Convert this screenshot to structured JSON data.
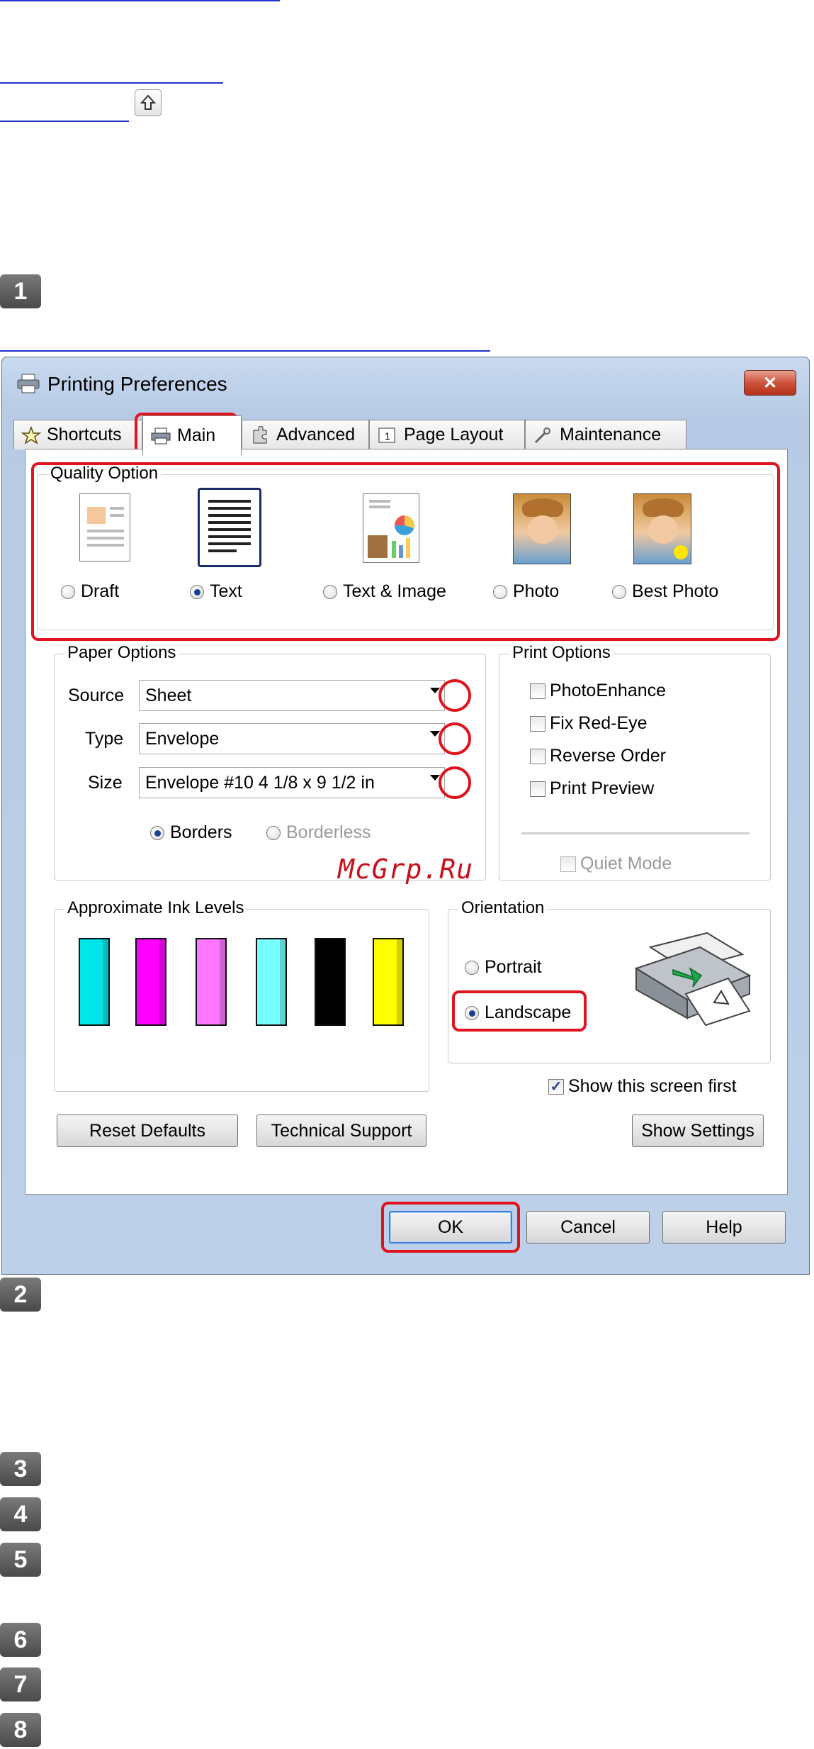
{
  "doc": {
    "steps": [
      "1",
      "2",
      "3",
      "4",
      "5",
      "6",
      "7",
      "8"
    ],
    "watermark": "McGrp.Ru"
  },
  "dialog": {
    "title": "Printing Preferences",
    "close_label": "✕",
    "tabs": [
      {
        "label": "Shortcuts",
        "icon": "star-icon"
      },
      {
        "label": "Main",
        "icon": "printer-icon",
        "active": true
      },
      {
        "label": "Advanced",
        "icon": "puzzle-icon"
      },
      {
        "label": "Page Layout",
        "icon": "page-layout-icon"
      },
      {
        "label": "Maintenance",
        "icon": "wrench-icon"
      }
    ],
    "quality": {
      "title": "Quality Option",
      "options": [
        {
          "label": "Draft",
          "selected": false
        },
        {
          "label": "Text",
          "selected": true
        },
        {
          "label": "Text & Image",
          "selected": false
        },
        {
          "label": "Photo",
          "selected": false
        },
        {
          "label": "Best Photo",
          "selected": false
        }
      ]
    },
    "paper": {
      "title": "Paper Options",
      "source_label": "Source",
      "source_value": "Sheet",
      "type_label": "Type",
      "type_value": "Envelope",
      "size_label": "Size",
      "size_value": "Envelope #10 4 1/8 x 9 1/2 in",
      "borders_label": "Borders",
      "borderless_label": "Borderless"
    },
    "print_options": {
      "title": "Print Options",
      "items": [
        "PhotoEnhance",
        "Fix Red-Eye",
        "Reverse Order",
        "Print Preview"
      ],
      "quiet_mode": "Quiet Mode"
    },
    "ink": {
      "title": "Approximate Ink Levels",
      "colors": [
        "#00e5e8",
        "#ff00ff",
        "#ff77ff",
        "#77ffff",
        "#000000",
        "#ffff00"
      ]
    },
    "orientation": {
      "title": "Orientation",
      "portrait": "Portrait",
      "landscape": "Landscape"
    },
    "show_first": "Show this screen first",
    "buttons": {
      "reset": "Reset Defaults",
      "tech": "Technical Support",
      "show_settings": "Show Settings",
      "ok": "OK",
      "cancel": "Cancel",
      "help": "Help"
    },
    "accent": "#e0141e"
  }
}
